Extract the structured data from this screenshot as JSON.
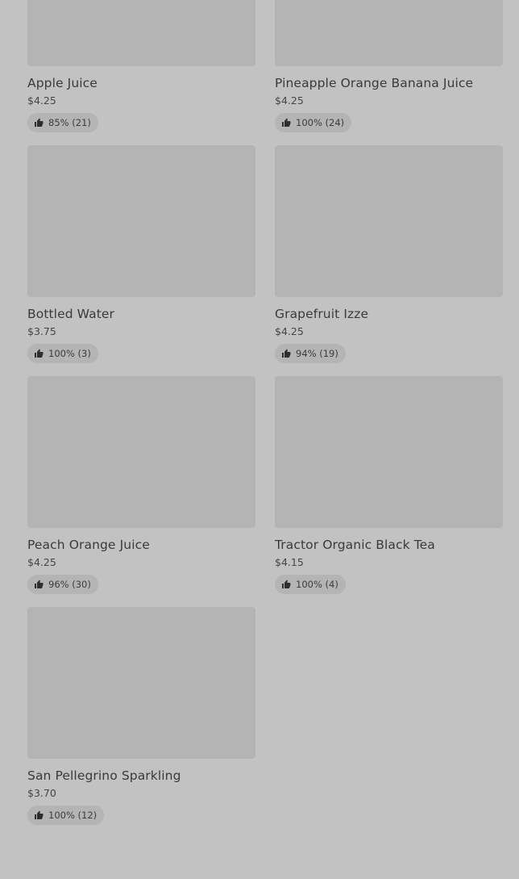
{
  "products": [
    {
      "name": "Apple Juice",
      "price": "$4.25",
      "rating": "85% (21)"
    },
    {
      "name": "Pineapple Orange Banana Juice",
      "price": "$4.25",
      "rating": "100% (24)"
    },
    {
      "name": "Bottled Water",
      "price": "$3.75",
      "rating": "100% (3)"
    },
    {
      "name": "Grapefruit Izze",
      "price": "$4.25",
      "rating": "94% (19)"
    },
    {
      "name": "Peach Orange Juice",
      "price": "$4.25",
      "rating": "96% (30)"
    },
    {
      "name": "Tractor Organic Black Tea",
      "price": "$4.15",
      "rating": "100% (4)"
    },
    {
      "name": "San Pellegrino Sparkling",
      "price": "$3.70",
      "rating": "100% (12)"
    }
  ],
  "icons": {
    "rating": "thumbs-up-icon"
  },
  "colors": {
    "background": "#c2c2c2",
    "placeholder": "#b4b4b4",
    "text": "#3a3a3a"
  }
}
